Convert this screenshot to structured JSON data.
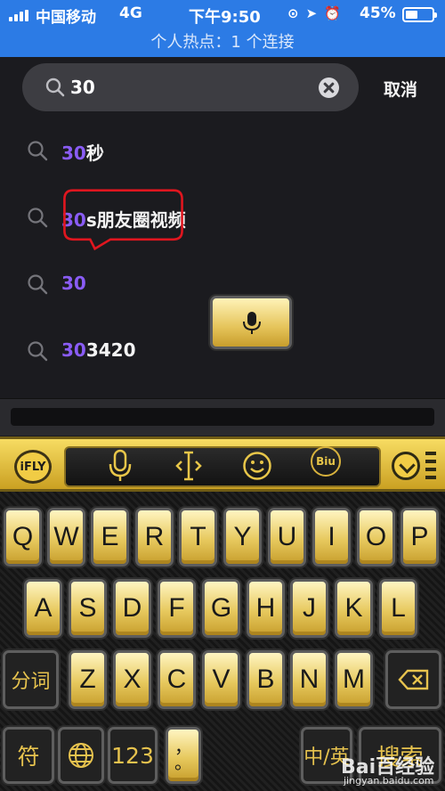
{
  "status_bar": {
    "carrier": "中国移动",
    "network": "4G",
    "time": "下午9:50",
    "battery_percent": "45%",
    "battery_level": 0.45,
    "hotspot_text": "个人热点：1 个连接",
    "icons": [
      "orientation-lock-icon",
      "location-icon",
      "alarm-icon"
    ]
  },
  "search": {
    "query": "30",
    "cancel_label": "取消"
  },
  "suggestions": [
    {
      "highlight": "30",
      "rest": "秒"
    },
    {
      "highlight": "30",
      "rest": "s朋友圈视频"
    },
    {
      "highlight": "30",
      "rest": ""
    },
    {
      "highlight": "30",
      "rest": "3420"
    }
  ],
  "colors": {
    "status_bar": "#2c7be5",
    "highlight": "#8a5cf5",
    "callout": "#e0161f",
    "key_gold": "#e7c95e"
  },
  "keyboard": {
    "toolbar": {
      "logo": "iFLY",
      "voice": "mic-icon",
      "cursor": "cursor-move-icon",
      "emoji": "smiley-icon",
      "biu": "Biu",
      "collapse": "chevron-down-icon"
    },
    "row1": [
      "Q",
      "W",
      "E",
      "R",
      "T",
      "Y",
      "U",
      "I",
      "O",
      "P"
    ],
    "row2": [
      "A",
      "S",
      "D",
      "F",
      "G",
      "H",
      "J",
      "K",
      "L"
    ],
    "row3": [
      "Z",
      "X",
      "C",
      "V",
      "B",
      "N",
      "M"
    ],
    "split_label": "分词",
    "backspace": "backspace-icon",
    "symbol_label": "符",
    "globe": "globe-icon",
    "number_label": "123",
    "punct_label": "，\n。",
    "space_icon": "mic-icon",
    "lang_label": "中/英",
    "search_label": "搜索"
  },
  "watermark": {
    "brand": "Bai百经验",
    "url": "jingyan.baidu.com"
  }
}
